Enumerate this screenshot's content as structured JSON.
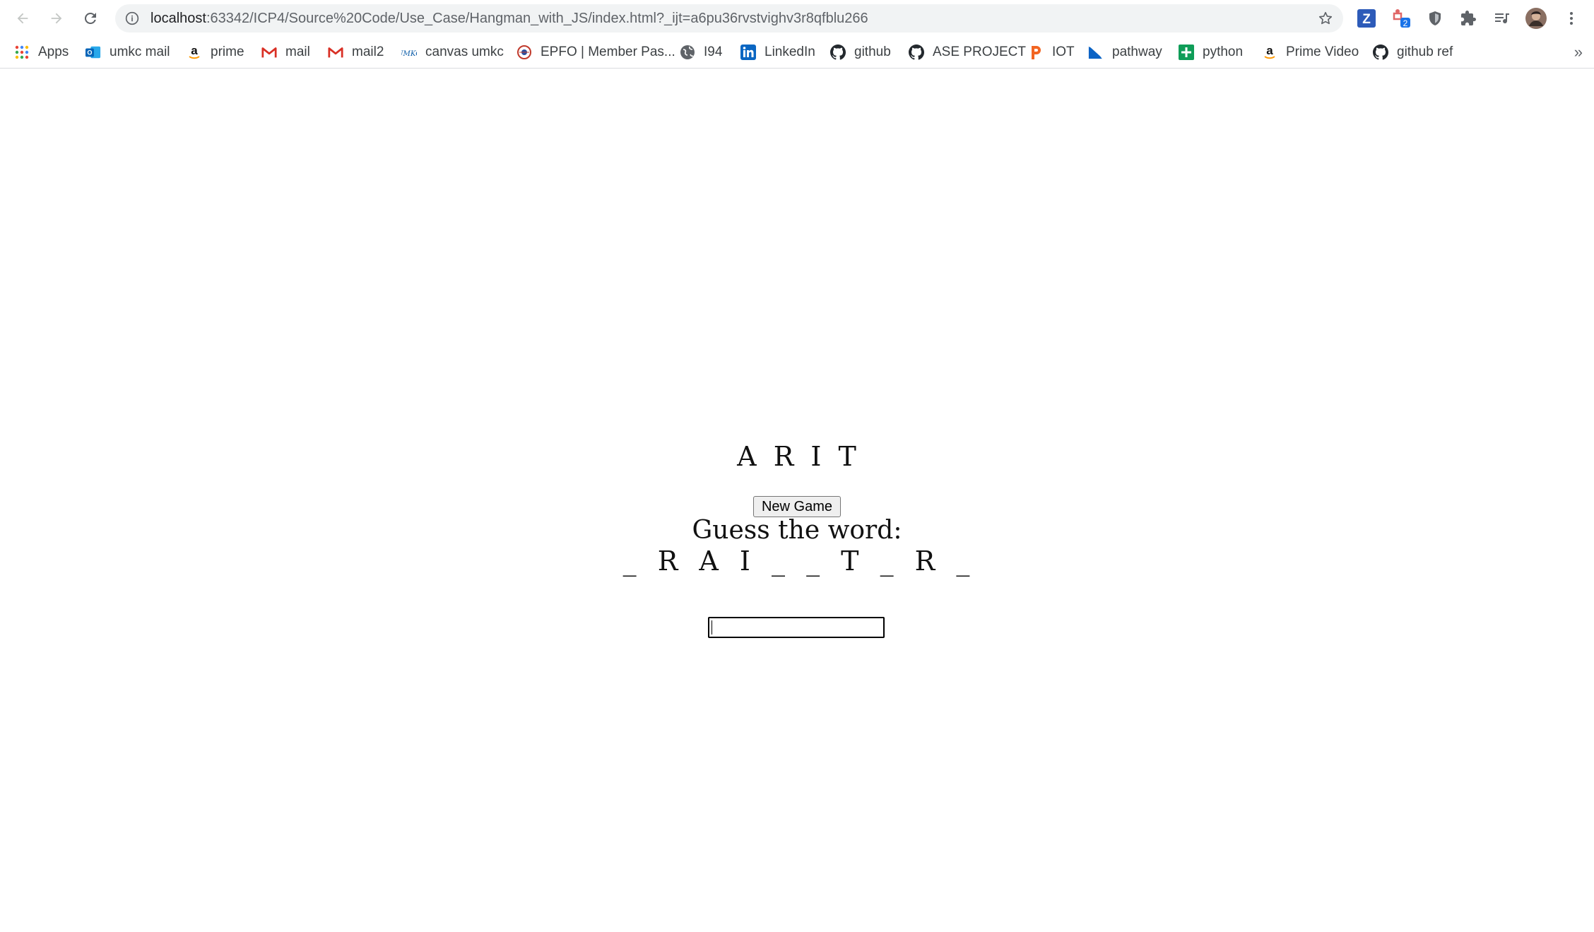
{
  "browser": {
    "url_host": "localhost",
    "url_path": ":63342/ICP4/Source%20Code/Use_Case/Hangman_with_JS/index.html?_ijt=a6pu36rvstvighv3r8qfblu266",
    "extensions": [
      "zoom-z-icon",
      "extension-badge-icon",
      "shield-icon",
      "puzzle-icon",
      "reading-list-icon",
      "profile-avatar"
    ],
    "extension_badge": "2"
  },
  "bookmarks": [
    {
      "label": "Apps",
      "icon": "apps-grid-icon"
    },
    {
      "label": "umkc mail",
      "icon": "outlook-icon"
    },
    {
      "label": "prime",
      "icon": "amazon-icon"
    },
    {
      "label": "mail",
      "icon": "gmail-icon"
    },
    {
      "label": "mail2",
      "icon": "gmail-icon"
    },
    {
      "label": "canvas umkc",
      "icon": "umkc-icon"
    },
    {
      "label": "EPFO | Member Pas...",
      "icon": "epfo-icon"
    },
    {
      "label": "I94",
      "icon": "globe-icon"
    },
    {
      "label": "LinkedIn",
      "icon": "linkedin-icon"
    },
    {
      "label": "github",
      "icon": "github-icon"
    },
    {
      "label": "ASE PROJECT",
      "icon": "github-icon"
    },
    {
      "label": "IOT",
      "icon": "p-icon"
    },
    {
      "label": "pathway",
      "icon": "pathway-icon"
    },
    {
      "label": "python",
      "icon": "sheets-icon"
    },
    {
      "label": "Prime Video",
      "icon": "amazon-icon"
    },
    {
      "label": "github ref",
      "icon": "github-icon"
    }
  ],
  "bookmarks_more": "»",
  "game": {
    "guessed_letters": "A R I T",
    "new_game_label": "New Game",
    "prompt": "Guess the word:",
    "word_display": "_ R A I _ _ T _ R _",
    "input_value": ""
  },
  "colors": {
    "omnibox_bg": "#f1f3f4",
    "text": "#111111",
    "gmail_red": "#d93025",
    "linkedin_blue": "#0a66c2",
    "iot_orange": "#f26522",
    "sheets_green": "#0f9d58"
  }
}
